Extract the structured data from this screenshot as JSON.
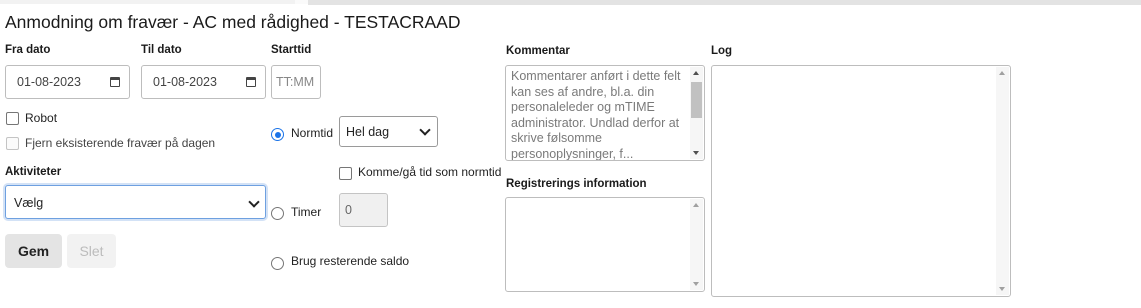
{
  "page": {
    "title": "Anmodning om fravær - AC med rådighed - TESTACRAAD"
  },
  "form": {
    "fra_dato": {
      "label": "Fra dato",
      "value": "01-08-2023"
    },
    "til_dato": {
      "label": "Til dato",
      "value": "01-08-2023"
    },
    "starttid": {
      "label": "Starttid",
      "placeholder": "TT:MM"
    },
    "robot_label": "Robot",
    "fjern_label": "Fjern eksisterende fravær på dagen",
    "aktiviteter": {
      "label": "Aktiviteter",
      "value": "Vælg"
    },
    "gem_label": "Gem",
    "slet_label": "Slet",
    "normtid": {
      "label": "Normtid",
      "select_value": "Hel dag",
      "checked": true
    },
    "komme_gaa_label": "Komme/gå tid som normtid",
    "timer": {
      "label": "Timer",
      "value": "0"
    },
    "brug_resterende_label": "Brug resterende saldo"
  },
  "kommentar": {
    "label": "Kommentar",
    "placeholder": "Kommentarer anført i dette felt kan ses af andre, bl.a. din personaleleder og mTIME administrator. Undlad derfor at skrive følsomme personoplysninger, f..."
  },
  "registrering": {
    "label": "Registrerings information"
  },
  "log": {
    "label": "Log"
  },
  "colors": {
    "accent": "#1a73e8",
    "focus_border": "#6ea0e0"
  },
  "icons": {
    "calendar": "calendar-icon",
    "dropdown": "chevron-down-icon"
  }
}
